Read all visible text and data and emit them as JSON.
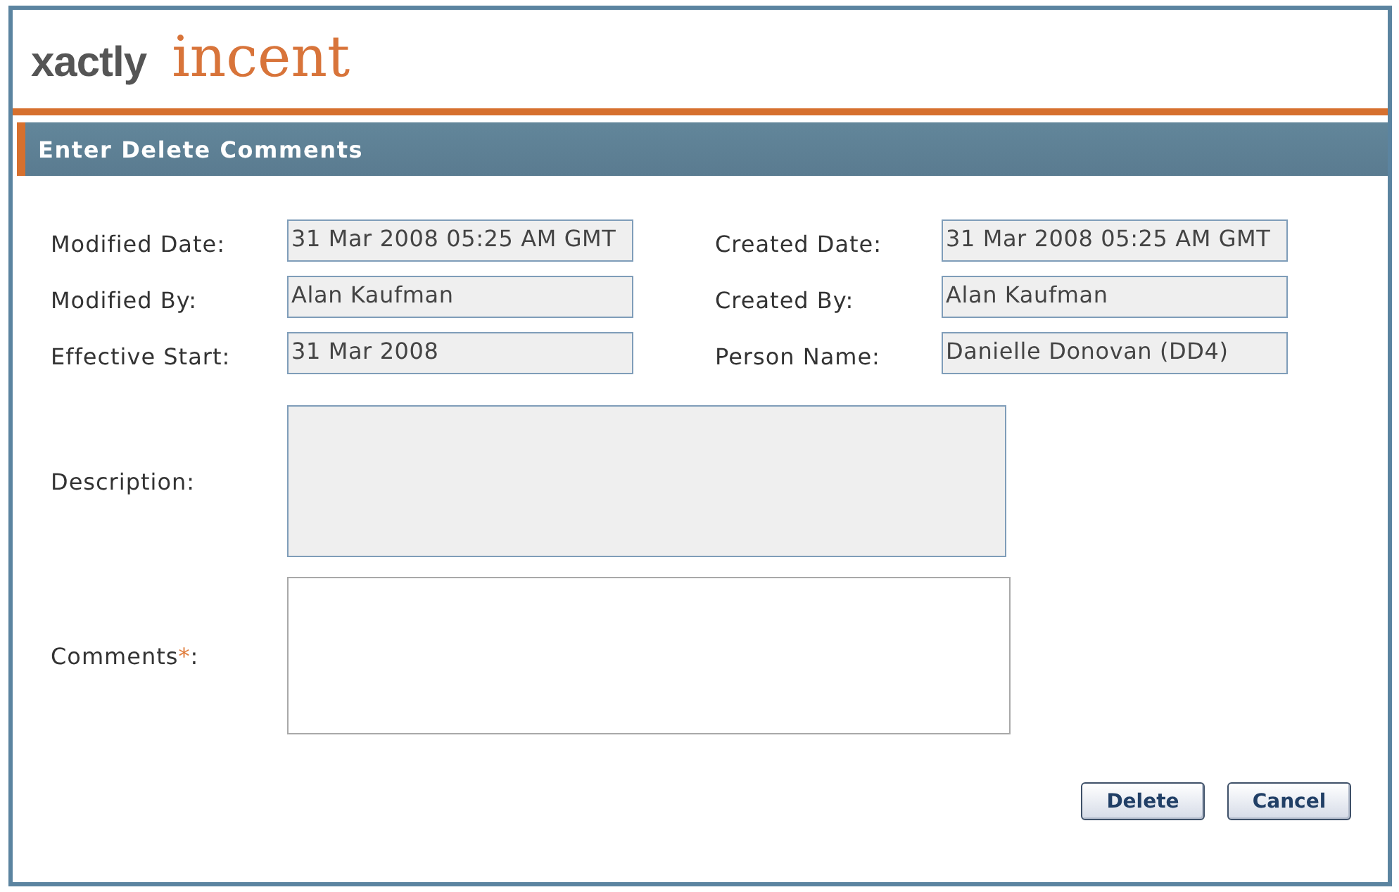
{
  "logo": {
    "brand": "xactly",
    "product": "incent"
  },
  "section": {
    "title": "Enter Delete Comments"
  },
  "fields": [
    {
      "label": "Modified Date:",
      "value": "31 Mar 2008 05:25 AM GMT",
      "readonly": true
    },
    {
      "label": "Created Date:",
      "value": "31 Mar 2008 05:25 AM GMT",
      "readonly": true
    },
    {
      "label": "Modified By:",
      "value": "Alan Kaufman",
      "readonly": true
    },
    {
      "label": "Created By:",
      "value": "Alan Kaufman",
      "readonly": true
    },
    {
      "label": "Effective Start:",
      "value": "31 Mar 2008",
      "readonly": true
    },
    {
      "label": "Person Name:",
      "value": "Danielle Donovan (DD4)",
      "readonly": true
    }
  ],
  "text_areas": [
    {
      "label": "Description:",
      "readonly": true
    },
    {
      "label": "Comments",
      "required_mark": "*",
      "label_end": ":",
      "readonly": false
    }
  ],
  "buttons": [
    {
      "label": "Delete"
    },
    {
      "label": "Cancel"
    }
  ]
}
